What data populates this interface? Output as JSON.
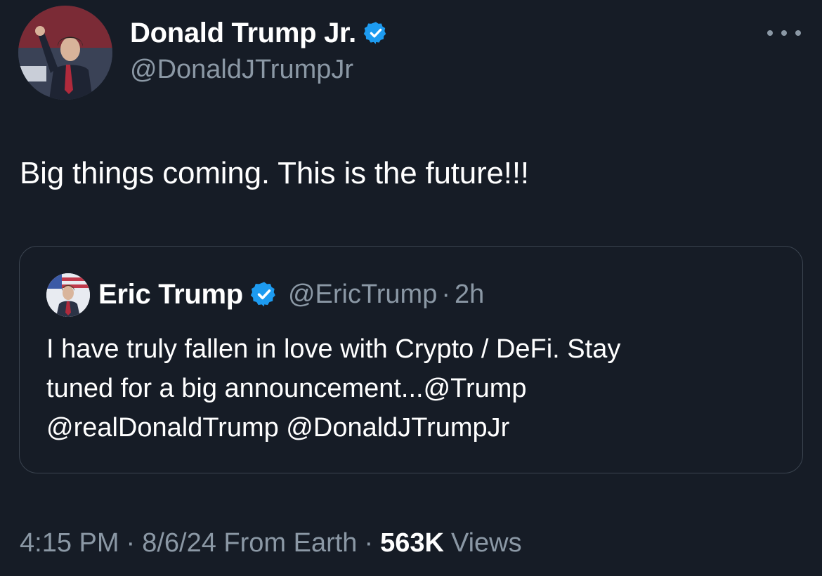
{
  "tweet": {
    "author": {
      "name": "Donald Trump Jr.",
      "handle": "@DonaldJTrumpJr",
      "verified_icon": "verified-badge-icon",
      "verified_color": "#1d9bf0"
    },
    "more_icon": "more-horizontal-icon",
    "text": "Big things coming. This is the future!!!",
    "quote": {
      "author_name": "Eric Trump",
      "handle": "@EricTrump",
      "separator": "·",
      "time": "2h",
      "lines": [
        "I have truly fallen in love with Crypto / DeFi. Stay",
        "tuned for a big announcement...@Trump",
        "@realDonaldTrump @DonaldJTrumpJr"
      ]
    },
    "meta": {
      "time": "4:15 PM",
      "separator": "·",
      "date_location": "8/6/24 From Earth",
      "views_count": "563K",
      "views_label": "Views"
    }
  },
  "colors": {
    "background": "#161c26",
    "text_primary": "#ffffff",
    "text_secondary": "#8b98a5",
    "border": "#3b4450",
    "accent": "#1d9bf0"
  }
}
